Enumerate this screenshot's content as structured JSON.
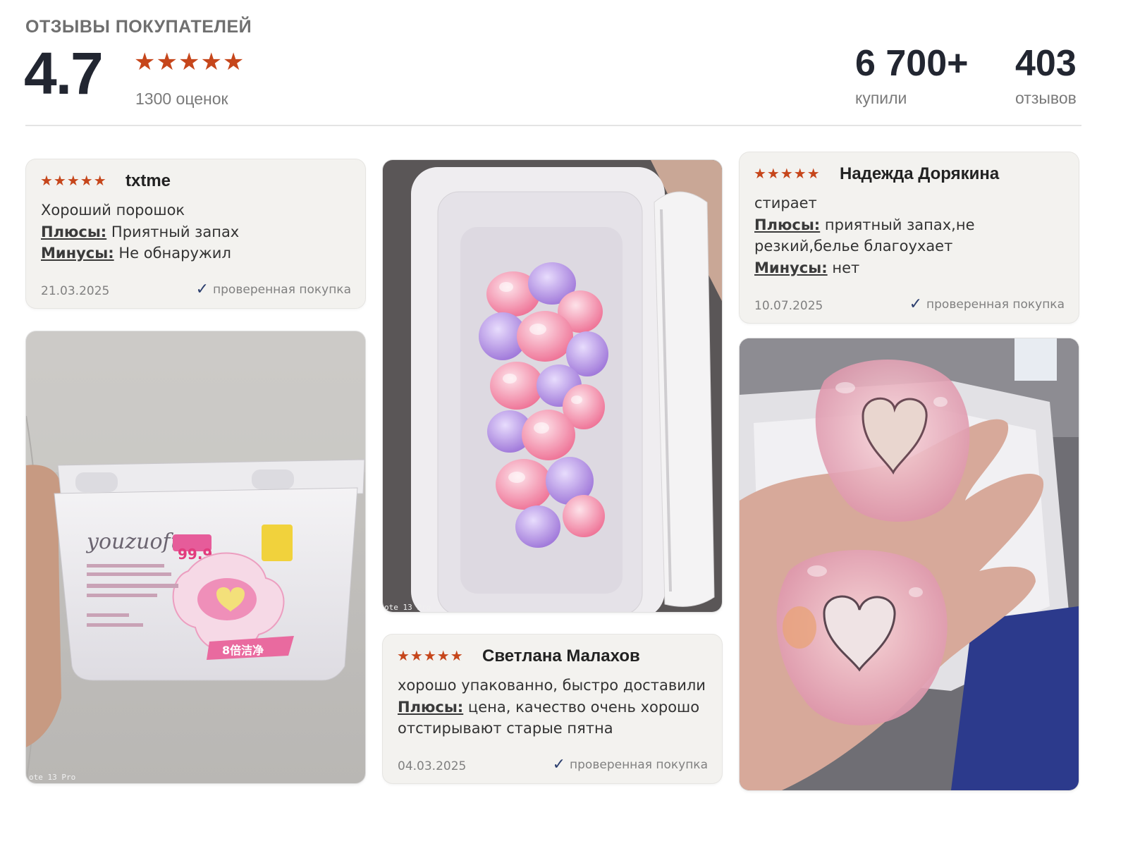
{
  "header": {
    "title": "ОТЗЫВЫ ПОКУПАТЕЛЕЙ",
    "rating": "4.7",
    "stars": "★★★★★",
    "ratings_count": "1300 оценок",
    "bought_value": "6 700+",
    "bought_label": "купили",
    "reviews_value": "403",
    "reviews_label": "отзывов"
  },
  "reviews": [
    {
      "stars": "★★★★★",
      "author": "txtme",
      "text": "Хороший порошок",
      "pros_label": "Плюсы:",
      "pros": "Приятный запах",
      "cons_label": "Минусы:",
      "cons": "Не обнаружил",
      "date": "21.03.2025",
      "verified": "проверенная покупка"
    },
    {
      "stars": "★★★★★",
      "author": "Светлана Малахов",
      "text": "хорошо упакованно, быстро доставили",
      "pros_label": "Плюсы:",
      "pros": "цена, качество очень хорошо отстирывают старые пятна",
      "date": "04.03.2025",
      "verified": "проверенная покупка"
    },
    {
      "stars": "★★★★★",
      "author": "Надежда Дорякина",
      "text": "стирает",
      "pros_label": "Плюсы:",
      "pros": "приятный запах,не резкий,белье благоухает",
      "cons_label": "Минусы:",
      "cons": "нет",
      "date": "10.07.2025",
      "verified": "проверенная покупка"
    }
  ],
  "photos": {
    "box_brand": "youzuofu",
    "box_percent": "99.9",
    "box_badge": "8倍洁净",
    "camera_stamp": "ote 13 Pro"
  },
  "colors": {
    "star": "#c6461b",
    "heading": "#222631",
    "card_bg": "#f3f2ef",
    "check": "#2c3f6e"
  }
}
